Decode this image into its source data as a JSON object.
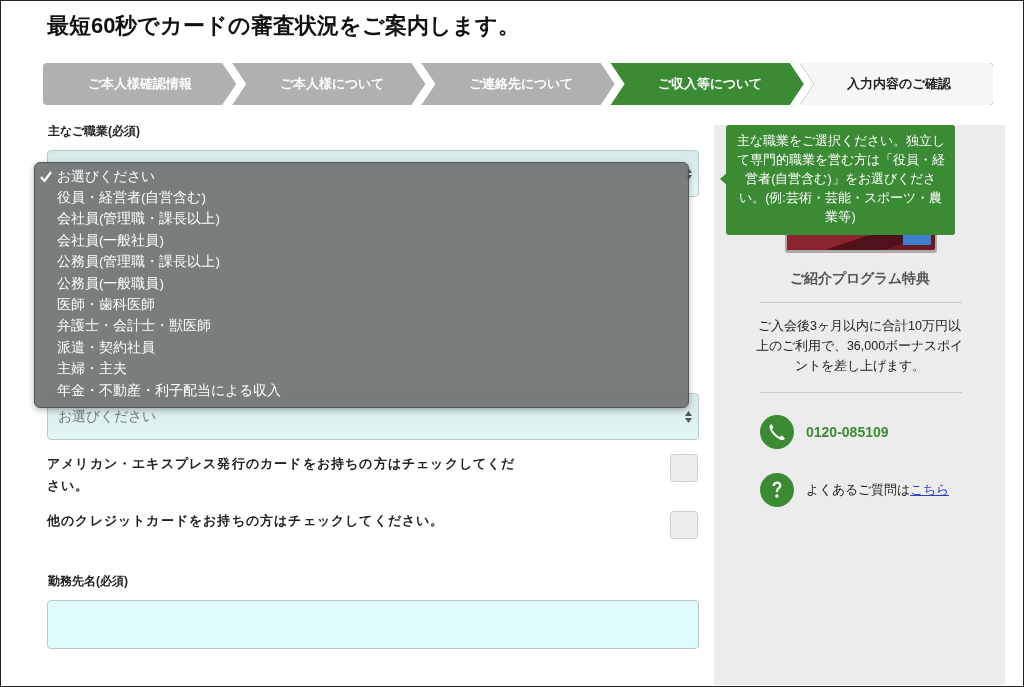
{
  "title": "最短60秒でカードの審査状況をご案内します。",
  "steps": [
    {
      "label": "ご本人様確認情報",
      "completed": true,
      "selected": false
    },
    {
      "label": "ご本人様について",
      "completed": true,
      "selected": false
    },
    {
      "label": "ご連絡先について",
      "completed": true,
      "selected": false
    },
    {
      "label": "ご収入等について",
      "completed": false,
      "selected": true
    },
    {
      "label": "入力内容のご確認",
      "completed": false,
      "selected": false
    }
  ],
  "form": {
    "occupation": {
      "label": "主なご職業(必須)",
      "expanded": true,
      "options": [
        {
          "label": "お選びください",
          "selected": true
        },
        {
          "label": "役員・経営者(自営含む)",
          "selected": false
        },
        {
          "label": "会社員(管理職・課長以上)",
          "selected": false
        },
        {
          "label": "会社員(一般社員)",
          "selected": false
        },
        {
          "label": "公務員(管理職・課長以上)",
          "selected": false
        },
        {
          "label": "公務員(一般職員)",
          "selected": false
        },
        {
          "label": "医師・歯科医師",
          "selected": false
        },
        {
          "label": "弁護士・会計士・獣医師",
          "selected": false
        },
        {
          "label": "派遣・契約社員",
          "selected": false
        },
        {
          "label": "主婦・主夫",
          "selected": false
        },
        {
          "label": "年金・不動産・利子配当による収入",
          "selected": false
        }
      ]
    },
    "second_select": {
      "placeholder": "お選びください"
    },
    "checkboxes": [
      {
        "label": "アメリカン・エキスプレス発行のカードをお持ちの方はチェックしてください。",
        "checked": false
      },
      {
        "label": "他のクレジットカードをお持ちの方はチェックしてください。",
        "checked": false
      }
    ],
    "employer": {
      "label": "勤務先名(必須)"
    }
  },
  "sidebar": {
    "tooltip": "主な職業をご選択ください。独立して専門的職業を営む方は「役員・経営者(自営含む)」をお選びください。(例:芸術・芸能・スポーツ・農業等)",
    "program_title": "ご紹介プログラム特典",
    "program_text": "ご入会後3ヶ月以内に合計10万円以上のご利用で、36,000ボーナスポイントを差し上げます。",
    "phone": "0120-085109",
    "faq": {
      "text": "よくあるご質問は",
      "link": "こちら"
    }
  }
}
